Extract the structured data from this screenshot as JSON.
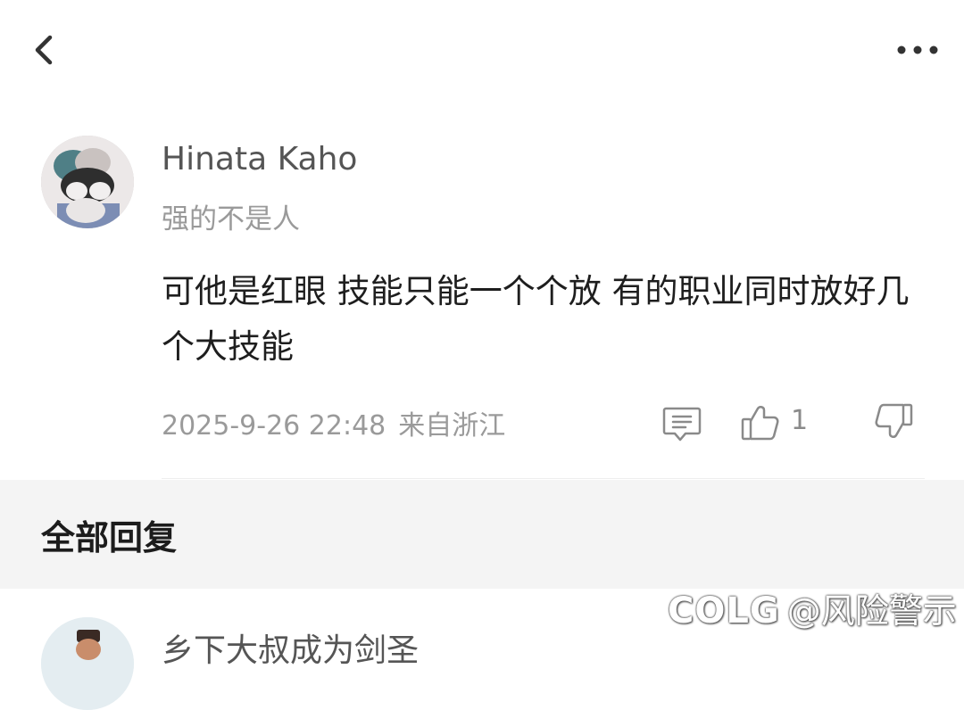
{
  "topbar": {
    "back_icon": "chevron-left-icon",
    "more_icon": "more-horizontal-icon"
  },
  "comment": {
    "username": "Hinata Kaho",
    "signature": "强的不是人",
    "text": "可他是红眼 技能只能一个个放 有的职业同时放好几个大技能",
    "timestamp": "2025-9-26 22:48",
    "location": "来自浙江",
    "like_count": "1",
    "icons": [
      "reply-icon",
      "thumb-up-icon",
      "thumb-down-icon"
    ]
  },
  "replies_section": {
    "title": "全部回复"
  },
  "next_reply": {
    "username": "乡下大叔成为剑圣"
  },
  "watermark": {
    "logo": "COLG",
    "text": "@风险警示"
  },
  "colors": {
    "text_primary": "#1e1e1e",
    "text_secondary": "#9a9a9a",
    "band_background": "#f4f4f4"
  }
}
